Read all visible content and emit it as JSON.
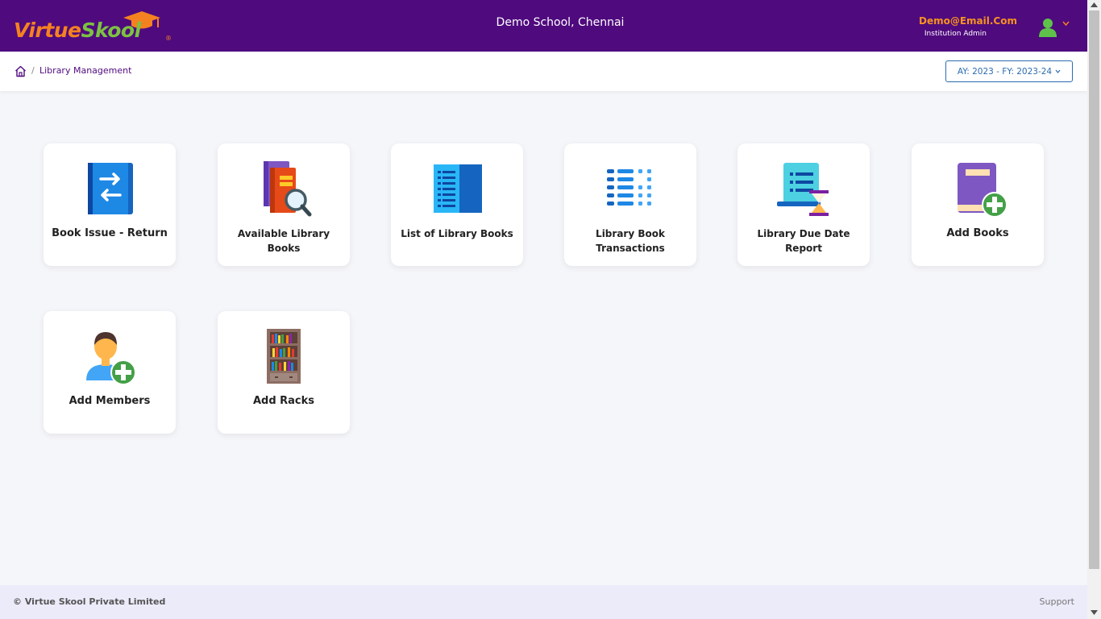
{
  "header": {
    "logo": {
      "part1": "Virtue",
      "part2": "Skool",
      "reg": "®"
    },
    "school_name": "Demo School, Chennai",
    "user_email": "Demo@Email.Com",
    "user_role": "Institution Admin"
  },
  "breadcrumb": {
    "separator": "/",
    "current": "Library Management"
  },
  "academic_year": {
    "value": "AY: 2023 - FY: 2023-24"
  },
  "tiles": [
    {
      "label": "Book Issue - Return",
      "icon": "book-exchange-icon"
    },
    {
      "label": "Available Library Books",
      "icon": "books-search-icon"
    },
    {
      "label": "List of Library Books",
      "icon": "book-list-icon"
    },
    {
      "label": "Library Book Transactions",
      "icon": "transactions-list-icon"
    },
    {
      "label": "Library Due Date Report",
      "icon": "due-date-report-icon"
    },
    {
      "label": "Add Books",
      "icon": "add-book-icon"
    },
    {
      "label": "Add Members",
      "icon": "add-member-icon"
    },
    {
      "label": "Add Racks",
      "icon": "bookshelf-icon"
    }
  ],
  "footer": {
    "copyright": "© Virtue Skool Private Limited",
    "support": "Support"
  },
  "colors": {
    "header_bg": "#4f0a7e",
    "accent_orange": "#f58220",
    "accent_green": "#7cc242",
    "link_blue": "#2b6cb0",
    "page_bg": "#f5f6fa",
    "footer_bg": "#ecebfa"
  }
}
